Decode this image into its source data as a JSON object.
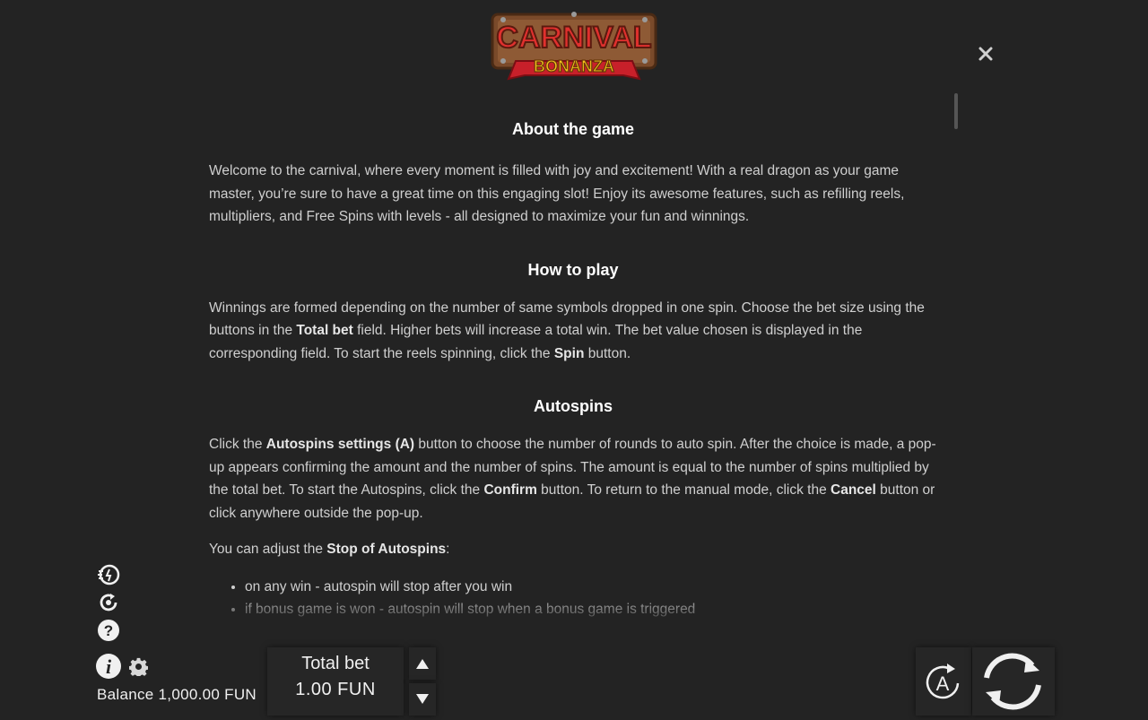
{
  "logo": {
    "line1": "CARNIVAL",
    "line2": "BONANZA"
  },
  "close_icon": "close-icon",
  "sections": {
    "about": {
      "title": "About the game",
      "text": "Welcome to the carnival, where every moment is filled with joy and excitement! With a real dragon as your game master, you’re sure to have a great time on this engaging slot! Enjoy its awesome features, such as refilling reels, multipliers, and Free Spins with levels - all designed to maximize your fun and winnings."
    },
    "how_to_play": {
      "title": "How to play",
      "p1": "Winnings are formed depending on the number of same symbols dropped in one spin. Choose the bet size using the buttons in the ",
      "b1": "Total bet",
      "p2": " field. Higher bets will increase a total win. The bet value chosen is displayed in the corresponding field. To start the reels spinning, click the ",
      "b2": "Spin",
      "p3": " button."
    },
    "autospins": {
      "title": "Autospins",
      "p1": "Click the ",
      "b1": "Autospins settings (A)",
      "p2": " button to choose the number of rounds to auto spin. After the choice is made, a pop-up appears confirming the amount and the number of spins. The amount is equal to the number of spins multiplied by the total bet. To start the Autospins, click the ",
      "b2": "Confirm",
      "p3": " button. To return to the manual mode, click the ",
      "b3": "Cancel",
      "p4": " button or click anywhere outside the pop-up.",
      "stop_p1": "You can adjust the ",
      "stop_b": "Stop of Autospins",
      "stop_p2": ":",
      "list": [
        "on any win - autospin will stop after you win",
        "if bonus game is won - autospin will stop when a bonus game is triggered"
      ]
    }
  },
  "side_icons": [
    "turbo-icon",
    "replay-icon",
    "help-icon",
    "info-icon",
    "gear-icon"
  ],
  "balance": "Balance 1,000.00 FUN",
  "bet": {
    "label": "Total bet",
    "value": "1.00 FUN"
  },
  "autospin_button": {
    "label": "A"
  },
  "colors": {
    "background": "#232323",
    "heading": "#ffffff",
    "body_text": "#cfcfcf",
    "panel": "#262626"
  }
}
